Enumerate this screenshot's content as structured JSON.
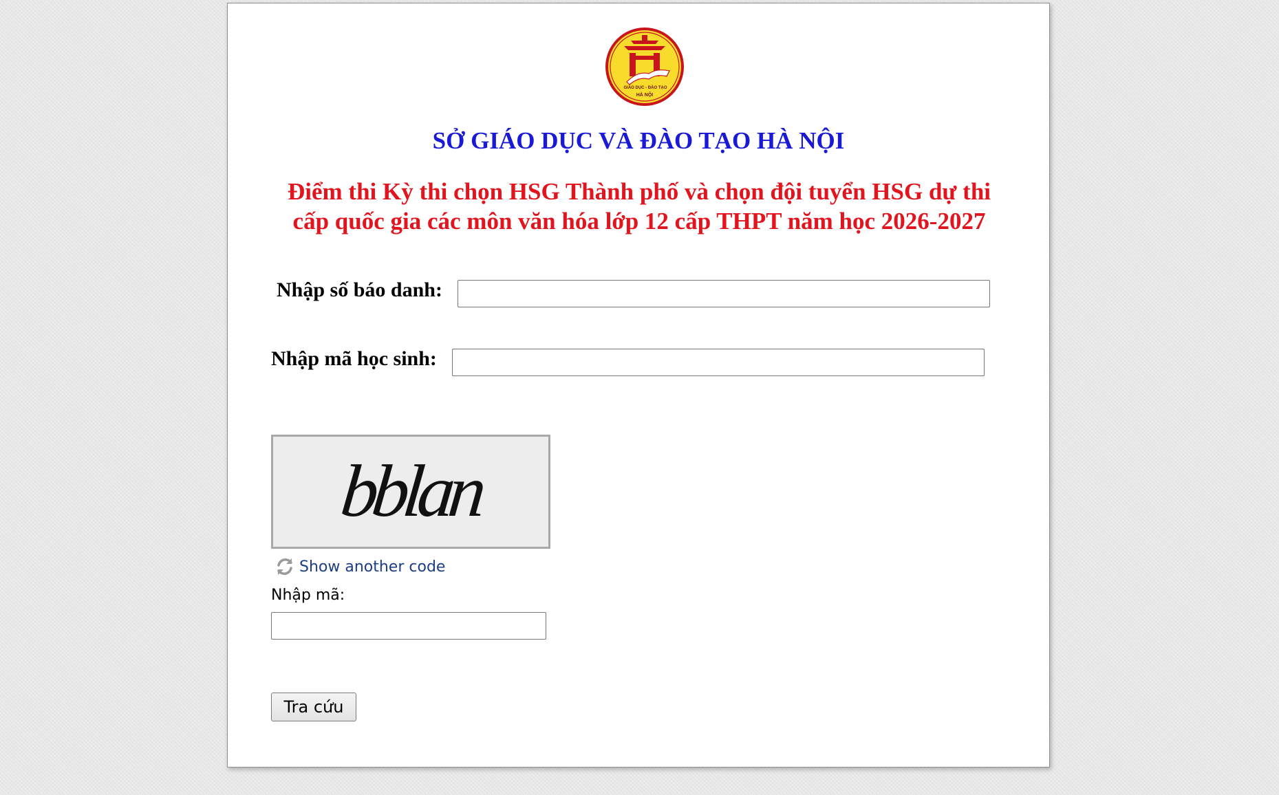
{
  "header": {
    "org_title": "SỞ GIÁO DỤC VÀ ĐÀO TẠO HÀ NỘI",
    "exam_title": "Điểm thi Kỳ thi chọn HSG Thành phố và chọn đội tuyển HSG dự thi cấp quốc gia các môn văn hóa lớp 12 cấp THPT năm học 2026-2027",
    "logo": {
      "name": "giao-duc-dao-tao-ha-noi-logo",
      "text_top": "GIÁO DỤC - ĐÀO TẠO",
      "text_bottom": "HÀ NỘI",
      "colors": {
        "fill": "#f7dc2c",
        "border": "#c8141b",
        "emblem": "#c8141b"
      }
    },
    "colors": {
      "org_title": "#1a1ad6",
      "exam_title": "#e2141e"
    }
  },
  "form": {
    "candidate_number": {
      "label": "Nhập số báo danh:",
      "value": "",
      "placeholder": ""
    },
    "student_code": {
      "label": "Nhập mã học sinh:",
      "value": "",
      "placeholder": ""
    },
    "captcha": {
      "image_text": "bblan",
      "refresh_icon": "refresh-icon",
      "refresh_label": "Show another code",
      "input_label": "Nhập mã:",
      "input_value": ""
    },
    "submit_label": "Tra cứu"
  }
}
